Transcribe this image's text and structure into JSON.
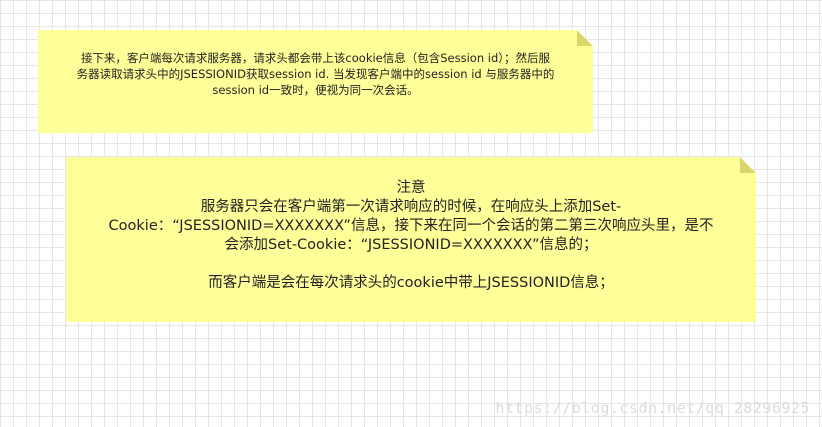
{
  "note1": {
    "lines": [
      "接下来，客户端每次请求服务器，请求头都会带上该cookie信息（包含Session id）；然后服",
      "务器读取请求头中的JSESSIONID获取session id. 当发现客户端中的session id 与服务器中的",
      "session id一致时，便视为同一次会话。"
    ]
  },
  "note2": {
    "title": "注意",
    "lines": [
      "服务器只会在客户端第一次请求响应的时候，在响应头上添加Set-",
      "Cookie：“JSESSIONID=XXXXXXX”信息，接下来在同一个会话的第二第三次响应头里，是不",
      "会添加Set-Cookie：“JSESSIONID=XXXXXXX”信息的；"
    ],
    "footer": "而客户端是会在每次请求头的cookie中带上JSESSIONID信息；"
  },
  "watermark": "https://blog.csdn.net/qq_28296925",
  "colors": {
    "note_fill": "#ffff99",
    "fold": "#d9d76a",
    "grid": "#e6e6e6"
  }
}
